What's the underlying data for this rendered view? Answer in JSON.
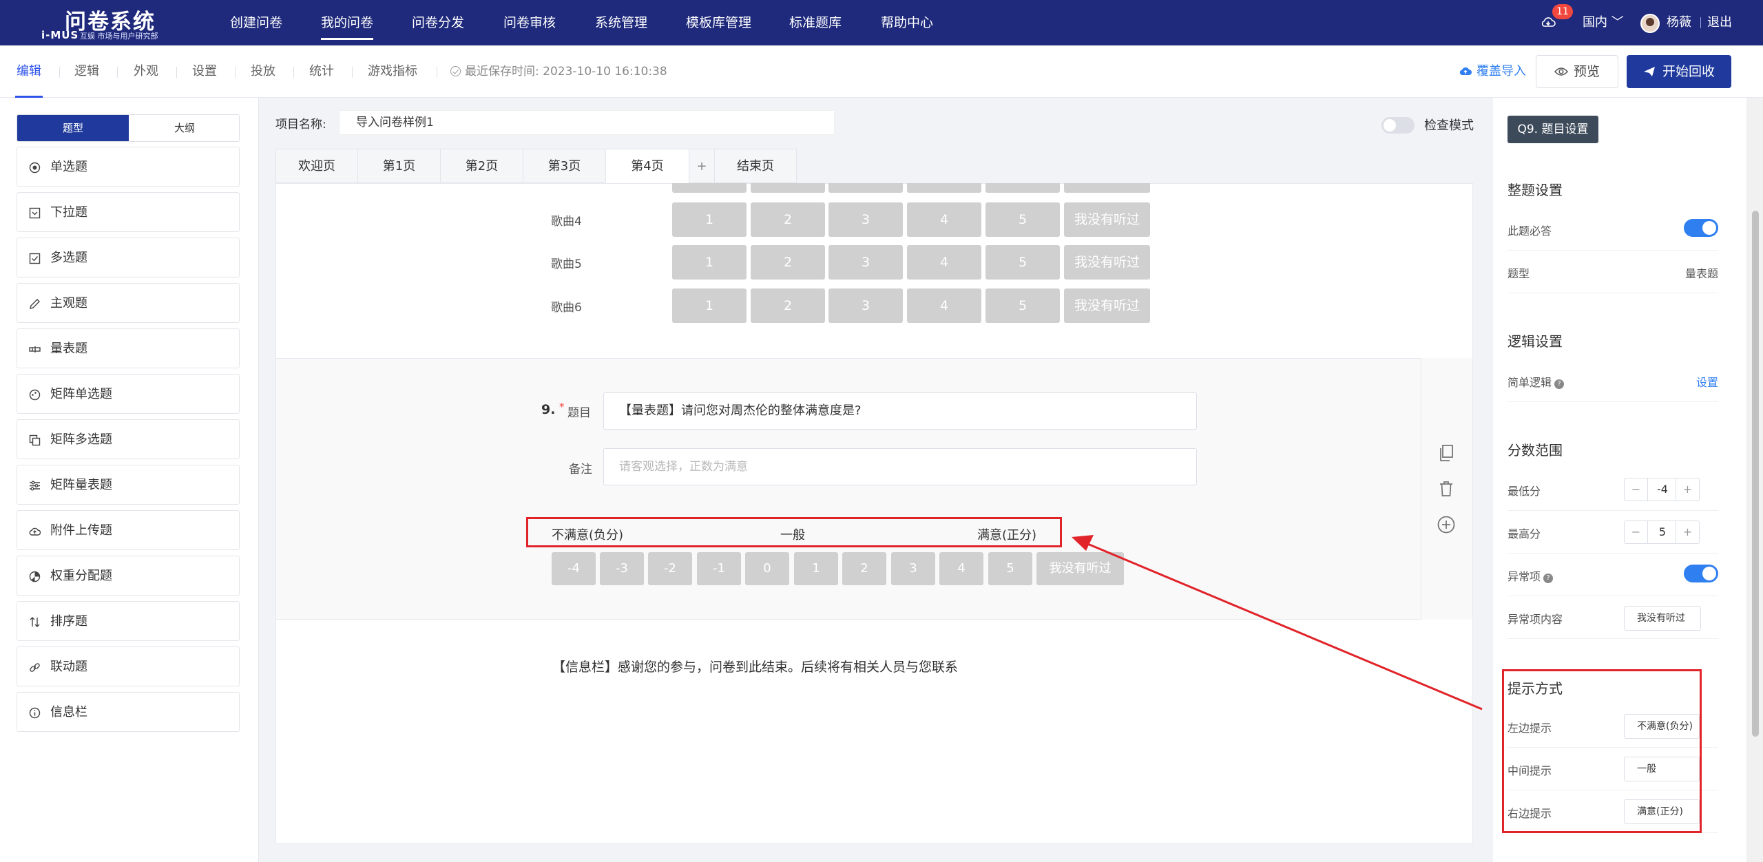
{
  "brand": {
    "title": "问卷系统",
    "mark": "i-MUS",
    "subtitle": "互娱 市场与用户研究部"
  },
  "nav": {
    "items": [
      "创建问卷",
      "我的问卷",
      "问卷分发",
      "问卷审核",
      "系统管理",
      "模板库管理",
      "标准题库",
      "帮助中心"
    ],
    "active": "我的问卷",
    "notifications": "11",
    "region": "国内",
    "username": "杨薇",
    "logout": "退出"
  },
  "toolbar": {
    "tabs": [
      "编辑",
      "逻辑",
      "外观",
      "设置",
      "投放",
      "统计",
      "游戏指标"
    ],
    "active": "编辑",
    "save_time": "最近保存时间: 2023-10-10 16:10:38",
    "import": "覆盖导入",
    "preview": "预览",
    "start": "开始回收"
  },
  "left": {
    "seg": [
      "题型",
      "大纲"
    ],
    "types": [
      "单选题",
      "下拉题",
      "多选题",
      "主观题",
      "量表题",
      "矩阵单选题",
      "矩阵多选题",
      "矩阵量表题",
      "附件上传题",
      "权重分配题",
      "排序题",
      "联动题",
      "信息栏"
    ]
  },
  "project": {
    "label": "项目名称:",
    "name": "导入问卷样例1",
    "check_mode": "检查模式"
  },
  "pages": [
    "欢迎页",
    "第1页",
    "第2页",
    "第3页",
    "第4页",
    "+",
    "结束页"
  ],
  "songs": {
    "rows": [
      "歌曲4",
      "歌曲5",
      "歌曲6"
    ],
    "options": [
      "1",
      "2",
      "3",
      "4",
      "5",
      "我没有听过"
    ]
  },
  "question": {
    "number": "9.",
    "required_mark": "*",
    "title_label": "题目",
    "title": "【量表题】请问您对周杰伦的整体满意度是?",
    "note_label": "备注",
    "note_placeholder": "请客观选择，正数为满意",
    "hints": {
      "left": "不满意(负分)",
      "middle": "一般",
      "right": "满意(正分)"
    },
    "scale": [
      "-4",
      "-3",
      "-2",
      "-1",
      "0",
      "1",
      "2",
      "3",
      "4",
      "5",
      "我没有听过"
    ]
  },
  "end_info": "【信息栏】感谢您的参与，问卷到此结束。后续将有相关人员与您联系",
  "settings": {
    "tag": "Q9. 题目设置",
    "whole": {
      "title": "整题设置",
      "required_label": "此题必答",
      "type_label": "题型",
      "type_value": "量表题"
    },
    "logic": {
      "title": "逻辑设置",
      "simple_label": "简单逻辑",
      "simple_link": "设置"
    },
    "range": {
      "title": "分数范围",
      "min_label": "最低分",
      "min": "-4",
      "max_label": "最高分",
      "max": "5",
      "abnormal_label": "异常项",
      "abnormal_content_label": "异常项内容",
      "abnormal_content": "我没有听过"
    },
    "hint": {
      "title": "提示方式",
      "left_label": "左边提示",
      "left": "不满意(负分)",
      "middle_label": "中间提示",
      "middle": "一般",
      "right_label": "右边提示",
      "right": "满意(正分)"
    }
  },
  "colors": {
    "nav": "#1f2a7c",
    "primary": "#1f3a9c",
    "link": "#2f7ff0",
    "annotation": "#e0242a",
    "scale_btn": "#d0d0d0"
  }
}
